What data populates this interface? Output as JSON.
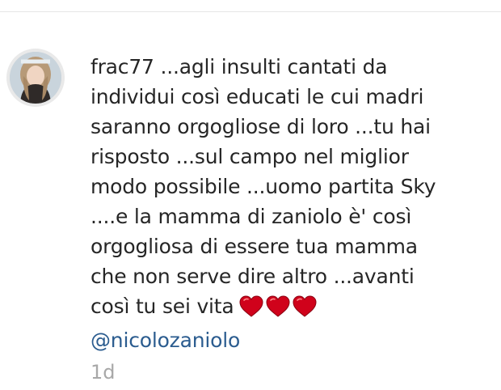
{
  "comment": {
    "username": "frac77",
    "text_lines": [
      " ...agli insulti cantati da",
      "individui così educati le cui madri",
      "saranno orgogliose di loro ...tu hai",
      "risposto ...sul campo nel miglior",
      "modo possibile ...uomo partita Sky",
      "....e la mamma di zaniolo è' così",
      "orgogliosa di essere tua mamma",
      "che non serve dire altro ...avanti",
      "così tu sei vita"
    ],
    "emoji": [
      "heart-icon",
      "heart-icon",
      "heart-icon"
    ],
    "mention": "@nicolozaniolo",
    "timestamp": "1d"
  },
  "colors": {
    "text": "#262626",
    "mention": "#2b5c8f",
    "timestamp": "#a8a8a8",
    "heart": "#d0021b"
  }
}
